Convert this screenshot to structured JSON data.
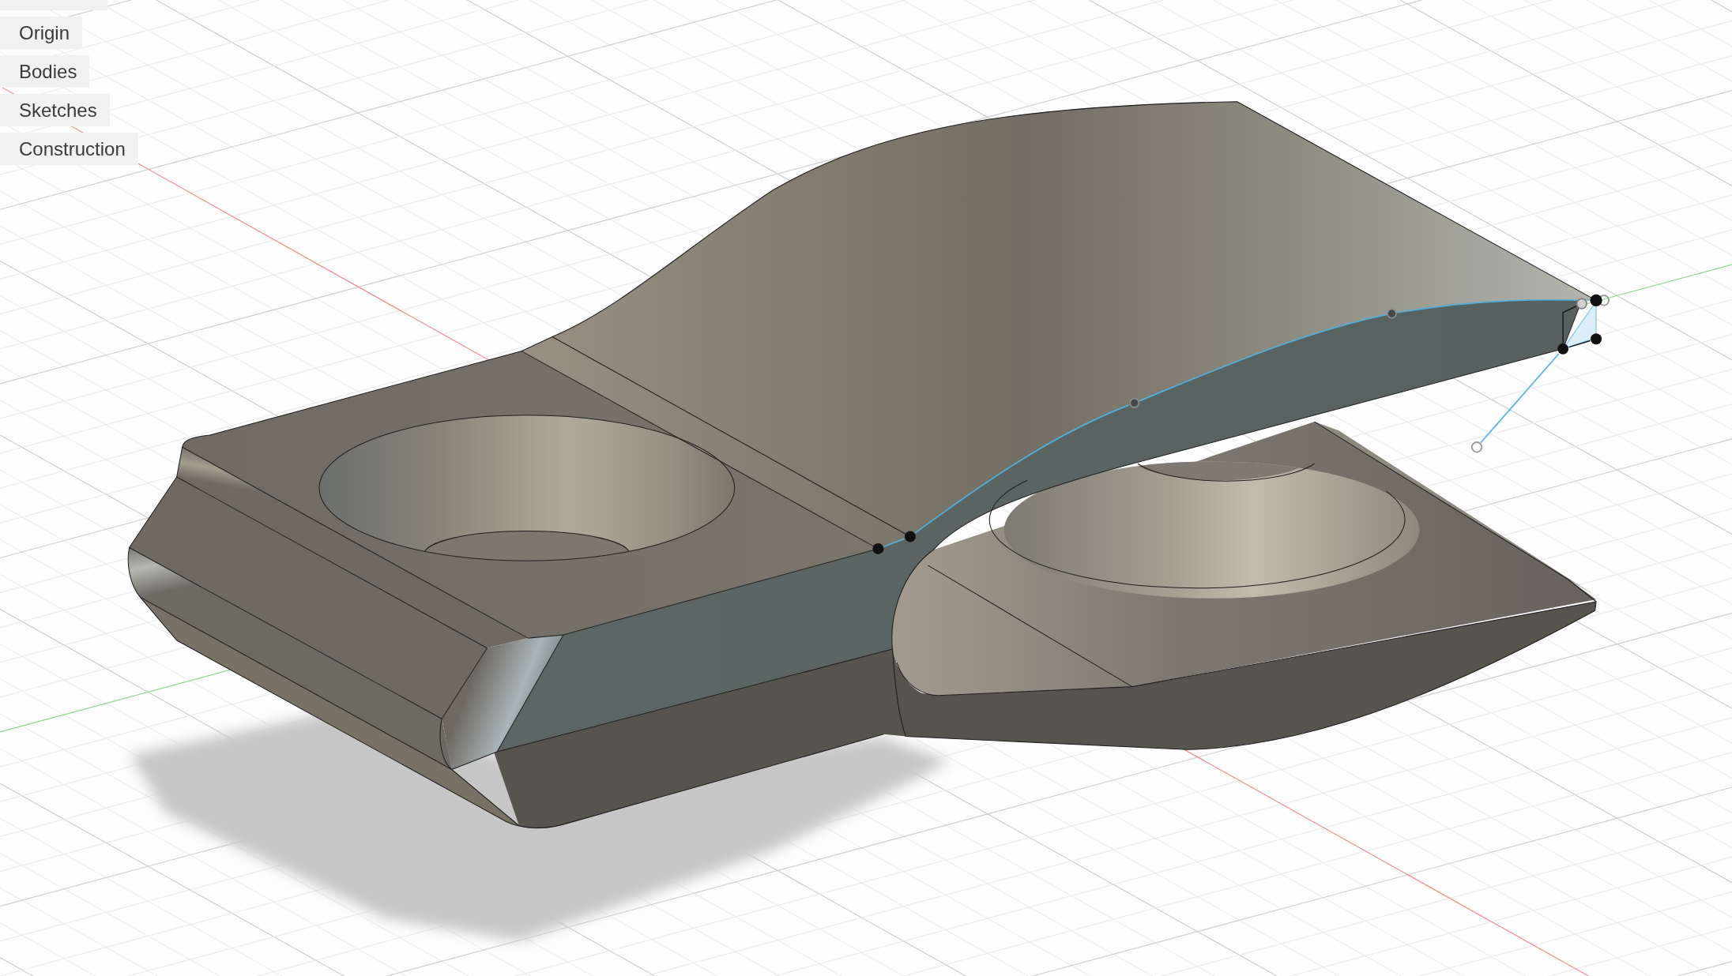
{
  "browser": {
    "items": [
      {
        "label": "Origin"
      },
      {
        "label": "Bodies"
      },
      {
        "label": "Sketches"
      },
      {
        "label": "Construction"
      }
    ]
  }
}
